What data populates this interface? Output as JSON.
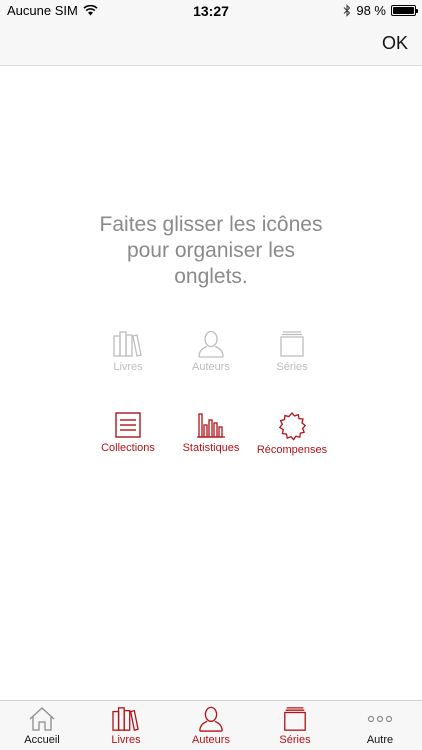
{
  "status_bar": {
    "carrier": "Aucune SIM",
    "time": "13:27",
    "battery_text": "98 %",
    "battery_level": 0.98
  },
  "nav_bar": {
    "done_label": "OK"
  },
  "instruction": {
    "lines": [
      "Faites glisser les icônes",
      "pour organiser les",
      "onglets."
    ]
  },
  "available_tabs": [
    {
      "label": "Livres",
      "icon": "books-icon"
    },
    {
      "label": "Auteurs",
      "icon": "person-icon"
    },
    {
      "label": "Séries",
      "icon": "stack-icon"
    }
  ],
  "more_tabs": [
    {
      "label": "Collections",
      "icon": "list-icon"
    },
    {
      "label": "Statistiques",
      "icon": "bar-chart-icon"
    },
    {
      "label": "Récompenses",
      "icon": "badge-icon"
    }
  ],
  "tab_bar": {
    "items": [
      {
        "label": "Accueil",
        "icon": "home-icon"
      },
      {
        "label": "Livres",
        "icon": "books-icon"
      },
      {
        "label": "Auteurs",
        "icon": "person-icon"
      },
      {
        "label": "Séries",
        "icon": "stack-icon"
      },
      {
        "label": "Autre",
        "icon": "more-icon"
      }
    ]
  },
  "colors": {
    "accent": "#b01318",
    "inactive": "#bdbdbd",
    "instruction_text": "#8a8a8a",
    "bar_background": "#f7f7f7"
  }
}
